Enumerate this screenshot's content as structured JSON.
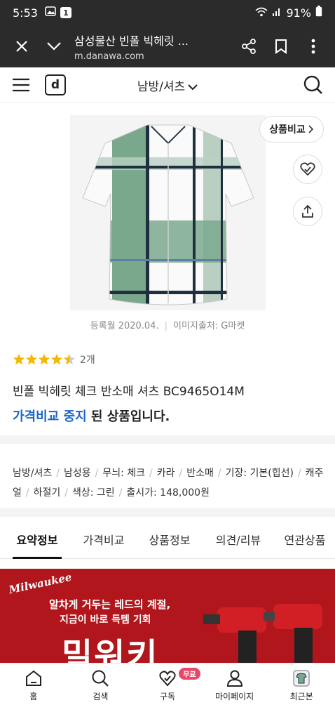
{
  "status_bar": {
    "time": "5:53",
    "notif_count": "1",
    "battery": "91%"
  },
  "browser": {
    "page_title": "삼성물산 빈폴 빅헤릿 ...",
    "url": "m.danawa.com"
  },
  "header": {
    "logo_letter": "d",
    "category": "남방/셔츠"
  },
  "product": {
    "compare_label": "상품비교",
    "registered": "등록월 2020.04.",
    "image_source": "이미지출처: G마켓",
    "rating": 4.5,
    "review_count": "2개",
    "title": "빈폴 빅헤릿 체크 반소매 셔츠 BC9465O14M",
    "status_prefix": "가격비교 중지",
    "status_suffix": " 된 상품입니다."
  },
  "specs": {
    "items": [
      "남방/셔츠",
      "남성용",
      "무늬: 체크",
      "카라",
      "반소매",
      "기장: 기본(힙선)",
      "캐주얼",
      "하절기",
      "색상: 그린",
      "출시가: 148,000원"
    ]
  },
  "tabs": [
    "요약정보",
    "가격비교",
    "상품정보",
    "의견/리뷰",
    "연관상품"
  ],
  "banner": {
    "brand": "Milwaukee",
    "line1": "알차게 거두는 레드의 계절,",
    "line2": "지금이 바로 득템 기회",
    "big": "밀워키"
  },
  "bottom_nav": {
    "home": "홈",
    "search": "검색",
    "subscribe": "구독",
    "free_badge": "무료",
    "mypage": "마이페이지",
    "recent": "최근본"
  },
  "colors": {
    "accent_blue": "#1965c8",
    "star": "#f5b800",
    "banner_red": "#b0161c",
    "badge_pink": "#e8476a"
  }
}
